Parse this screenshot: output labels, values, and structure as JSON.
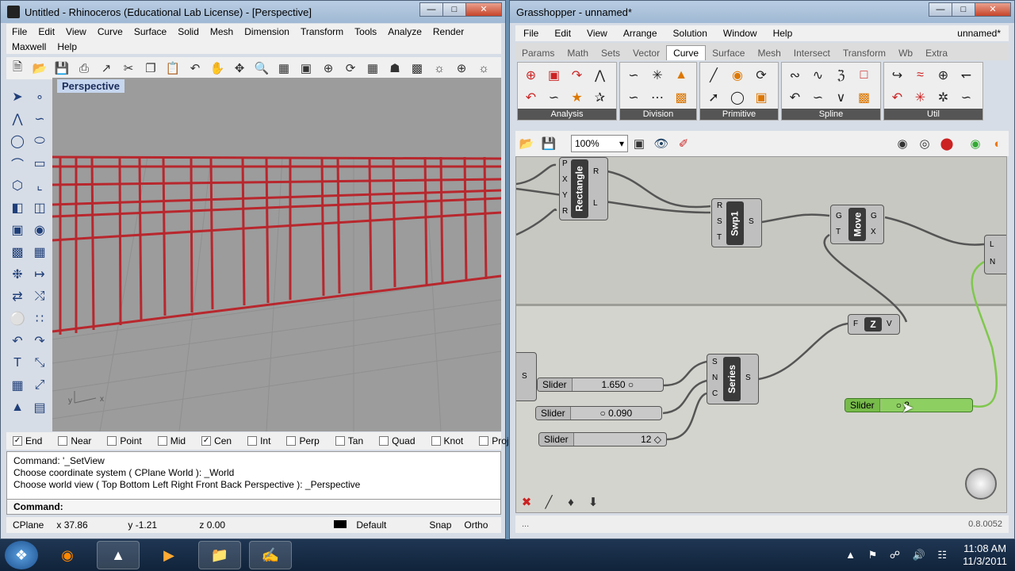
{
  "rhino": {
    "title": "Untitled - Rhinoceros (Educational Lab License) - [Perspective]",
    "menus_row1": [
      "File",
      "Edit",
      "View",
      "Curve",
      "Surface",
      "Solid",
      "Mesh",
      "Dimension",
      "Transform",
      "Tools",
      "Analyze",
      "Render"
    ],
    "menus_row2": [
      "Maxwell",
      "Help"
    ],
    "viewport_label": "Perspective",
    "axis": {
      "x": "x",
      "y": "y"
    },
    "osnaps": [
      {
        "label": "End",
        "checked": true
      },
      {
        "label": "Near",
        "checked": false
      },
      {
        "label": "Point",
        "checked": false
      },
      {
        "label": "Mid",
        "checked": false
      },
      {
        "label": "Cen",
        "checked": true
      },
      {
        "label": "Int",
        "checked": false
      },
      {
        "label": "Perp",
        "checked": false
      },
      {
        "label": "Tan",
        "checked": false
      },
      {
        "label": "Quad",
        "checked": false
      },
      {
        "label": "Knot",
        "checked": false
      },
      {
        "label": "Project",
        "checked": false
      }
    ],
    "command_history": [
      "Command: '_SetView",
      "Choose coordinate system ( CPlane  World ): _World",
      "Choose world view ( Top  Bottom  Left  Right  Front  Back  Perspective ): _Perspective"
    ],
    "command_prompt": "Command:",
    "status": {
      "cplane": "CPlane",
      "x": "x 37.86",
      "y": "y -1.21",
      "z": "z 0.00",
      "layer": "Default",
      "snap": "Snap",
      "ortho": "Ortho"
    }
  },
  "grasshopper": {
    "title": "Grasshopper - unnamed*",
    "menus": [
      "File",
      "Edit",
      "View",
      "Arrange",
      "Solution",
      "Window",
      "Help"
    ],
    "doc_name": "unnamed*",
    "tabs": [
      "Params",
      "Math",
      "Sets",
      "Vector",
      "Curve",
      "Surface",
      "Mesh",
      "Intersect",
      "Transform",
      "Wb",
      "Extra"
    ],
    "active_tab": "Curve",
    "palettes": [
      "Analysis",
      "Division",
      "Primitive",
      "Spline",
      "Util"
    ],
    "zoom": "100%",
    "components": {
      "rectangle": {
        "name": "Rectangle",
        "inputs": [
          "P",
          "X",
          "Y",
          "R"
        ],
        "outputs": [
          "R",
          "L"
        ]
      },
      "swp1": {
        "name": "Swp1",
        "inputs": [
          "R",
          "S",
          "T"
        ],
        "outputs": [
          "S"
        ]
      },
      "move": {
        "name": "Move",
        "inputs": [
          "G",
          "T"
        ],
        "outputs": [
          "G",
          "X"
        ]
      },
      "z": {
        "name": "Z",
        "inputs": [
          "F"
        ],
        "outputs": [
          "V"
        ]
      },
      "series": {
        "name": "Series",
        "inputs": [
          "S",
          "N",
          "C"
        ],
        "outputs": [
          "S"
        ]
      },
      "partial": {
        "inputs": [
          "L",
          "N"
        ]
      },
      "left_partial": {
        "outputs": [
          "S"
        ]
      }
    },
    "sliders": [
      {
        "name": "Slider",
        "value": "1.650 ○"
      },
      {
        "name": "Slider",
        "value": "○ 0.090"
      },
      {
        "name": "Slider",
        "value": "12 ◇"
      },
      {
        "name": "Slider",
        "value": "○ 2"
      }
    ],
    "version": "0.8.0052",
    "status_left": "..."
  },
  "taskbar": {
    "time": "11:08 AM",
    "date": "11/3/2011"
  }
}
